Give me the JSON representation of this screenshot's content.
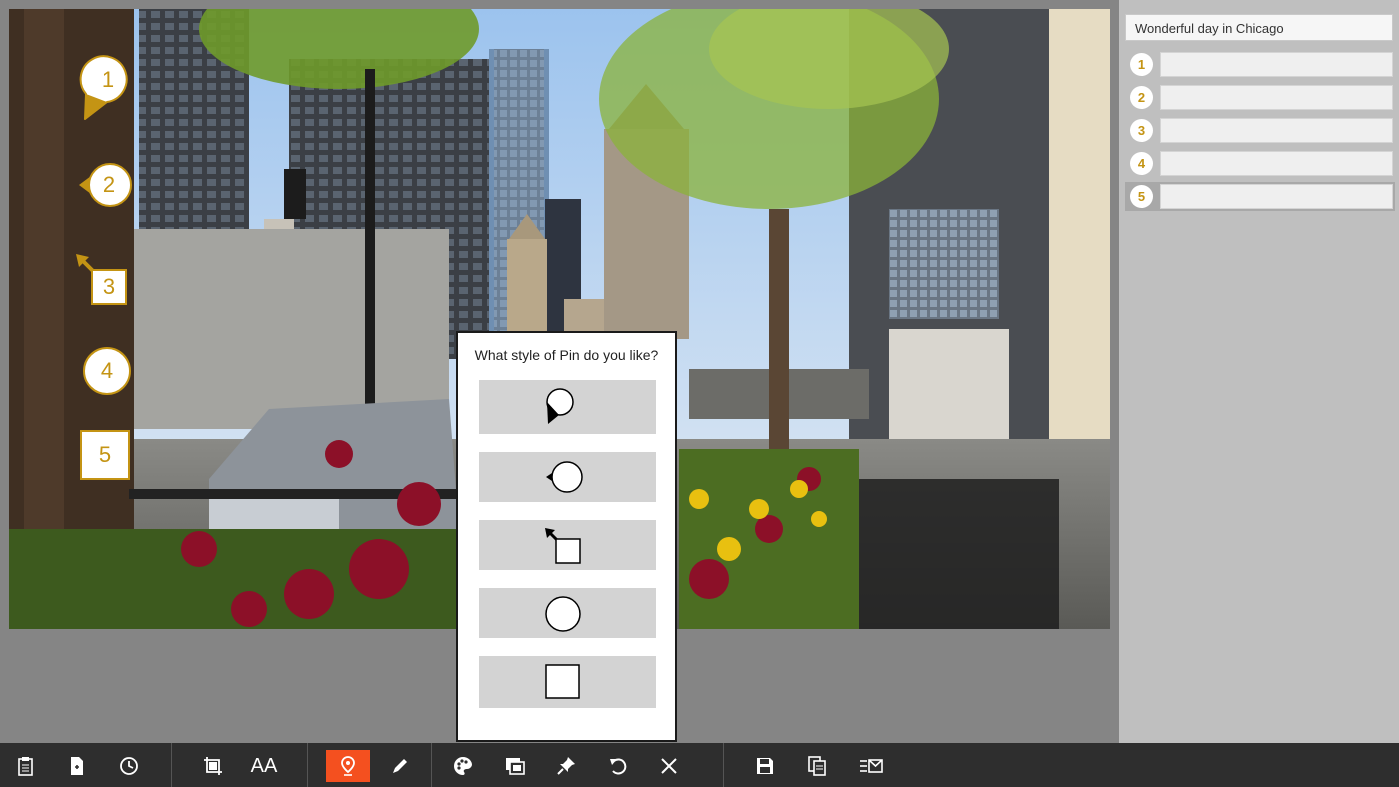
{
  "pins": [
    "1",
    "2",
    "3",
    "4",
    "5"
  ],
  "dialog": {
    "title": "What style of Pin do you like?",
    "options": [
      {
        "icon": "speech-bubble-pin-icon"
      },
      {
        "icon": "left-pointer-circle-pin-icon"
      },
      {
        "icon": "arrow-square-pin-icon"
      },
      {
        "icon": "circle-pin-icon"
      },
      {
        "icon": "square-pin-icon"
      }
    ]
  },
  "panel": {
    "title_value": "Wonderful day in Chicago",
    "rows": [
      {
        "num": "1",
        "value": ""
      },
      {
        "num": "2",
        "value": ""
      },
      {
        "num": "3",
        "value": ""
      },
      {
        "num": "4",
        "value": ""
      },
      {
        "num": "5",
        "value": ""
      }
    ],
    "active_row": "5"
  },
  "toolbar": {
    "aa_label": "AA",
    "buttons": [
      "paste-icon",
      "new-file-icon",
      "history-icon",
      "crop-icon",
      "text-size-icon",
      "pin-tool-icon",
      "pen-icon",
      "palette-icon",
      "layers-icon",
      "pushpin-icon",
      "undo-icon",
      "close-icon",
      "save-icon",
      "copy-icon",
      "send-icon"
    ],
    "active": "pin-tool-icon"
  },
  "colors": {
    "accent": "#f4501f",
    "pin_gold": "#c49414",
    "toolbar_bg": "#2e2e2e",
    "panel_bg": "#bfbfbf",
    "workspace_bg": "#858585"
  }
}
